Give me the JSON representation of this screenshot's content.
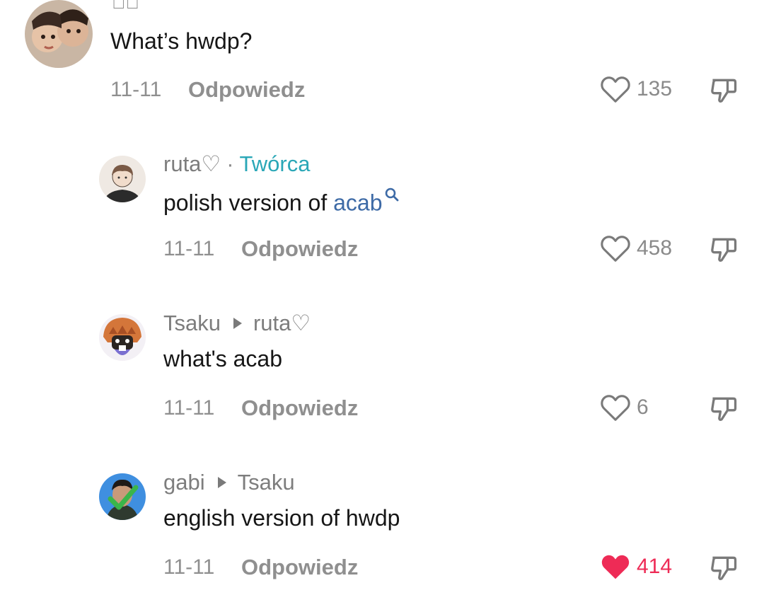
{
  "comments": [
    {
      "username": "ร̈ฏ̈",
      "text": "What’s hwdp?",
      "date": "11-11",
      "reply_label": "Odpowiedz",
      "likes": "135",
      "liked": false
    },
    {
      "username": "ruta♡",
      "badge": "Twórca",
      "separator": "·",
      "text_prefix": "polish version of ",
      "text_link": "acab",
      "date": "11-11",
      "reply_label": "Odpowiedz",
      "likes": "458",
      "liked": false
    },
    {
      "username": "Tsaku",
      "reply_to": "ruta♡",
      "text": "what's acab",
      "date": "11-11",
      "reply_label": "Odpowiedz",
      "likes": "6",
      "liked": false
    },
    {
      "username": "gabi",
      "reply_to": "Tsaku",
      "text": "english version of hwdp",
      "date": "11-11",
      "reply_label": "Odpowiedz",
      "likes": "414",
      "liked": true
    }
  ],
  "colors": {
    "creator_badge": "#2aa7b7",
    "link": "#3d6aa6",
    "liked_heart": "#ee2b56",
    "muted_text": "#8f8f8f"
  },
  "icons": {
    "like": "heart-outline-icon",
    "liked": "heart-filled-icon",
    "dislike": "thumbs-down-icon",
    "link_search": "search-icon",
    "reply_arrow": "triangle-right-icon"
  }
}
